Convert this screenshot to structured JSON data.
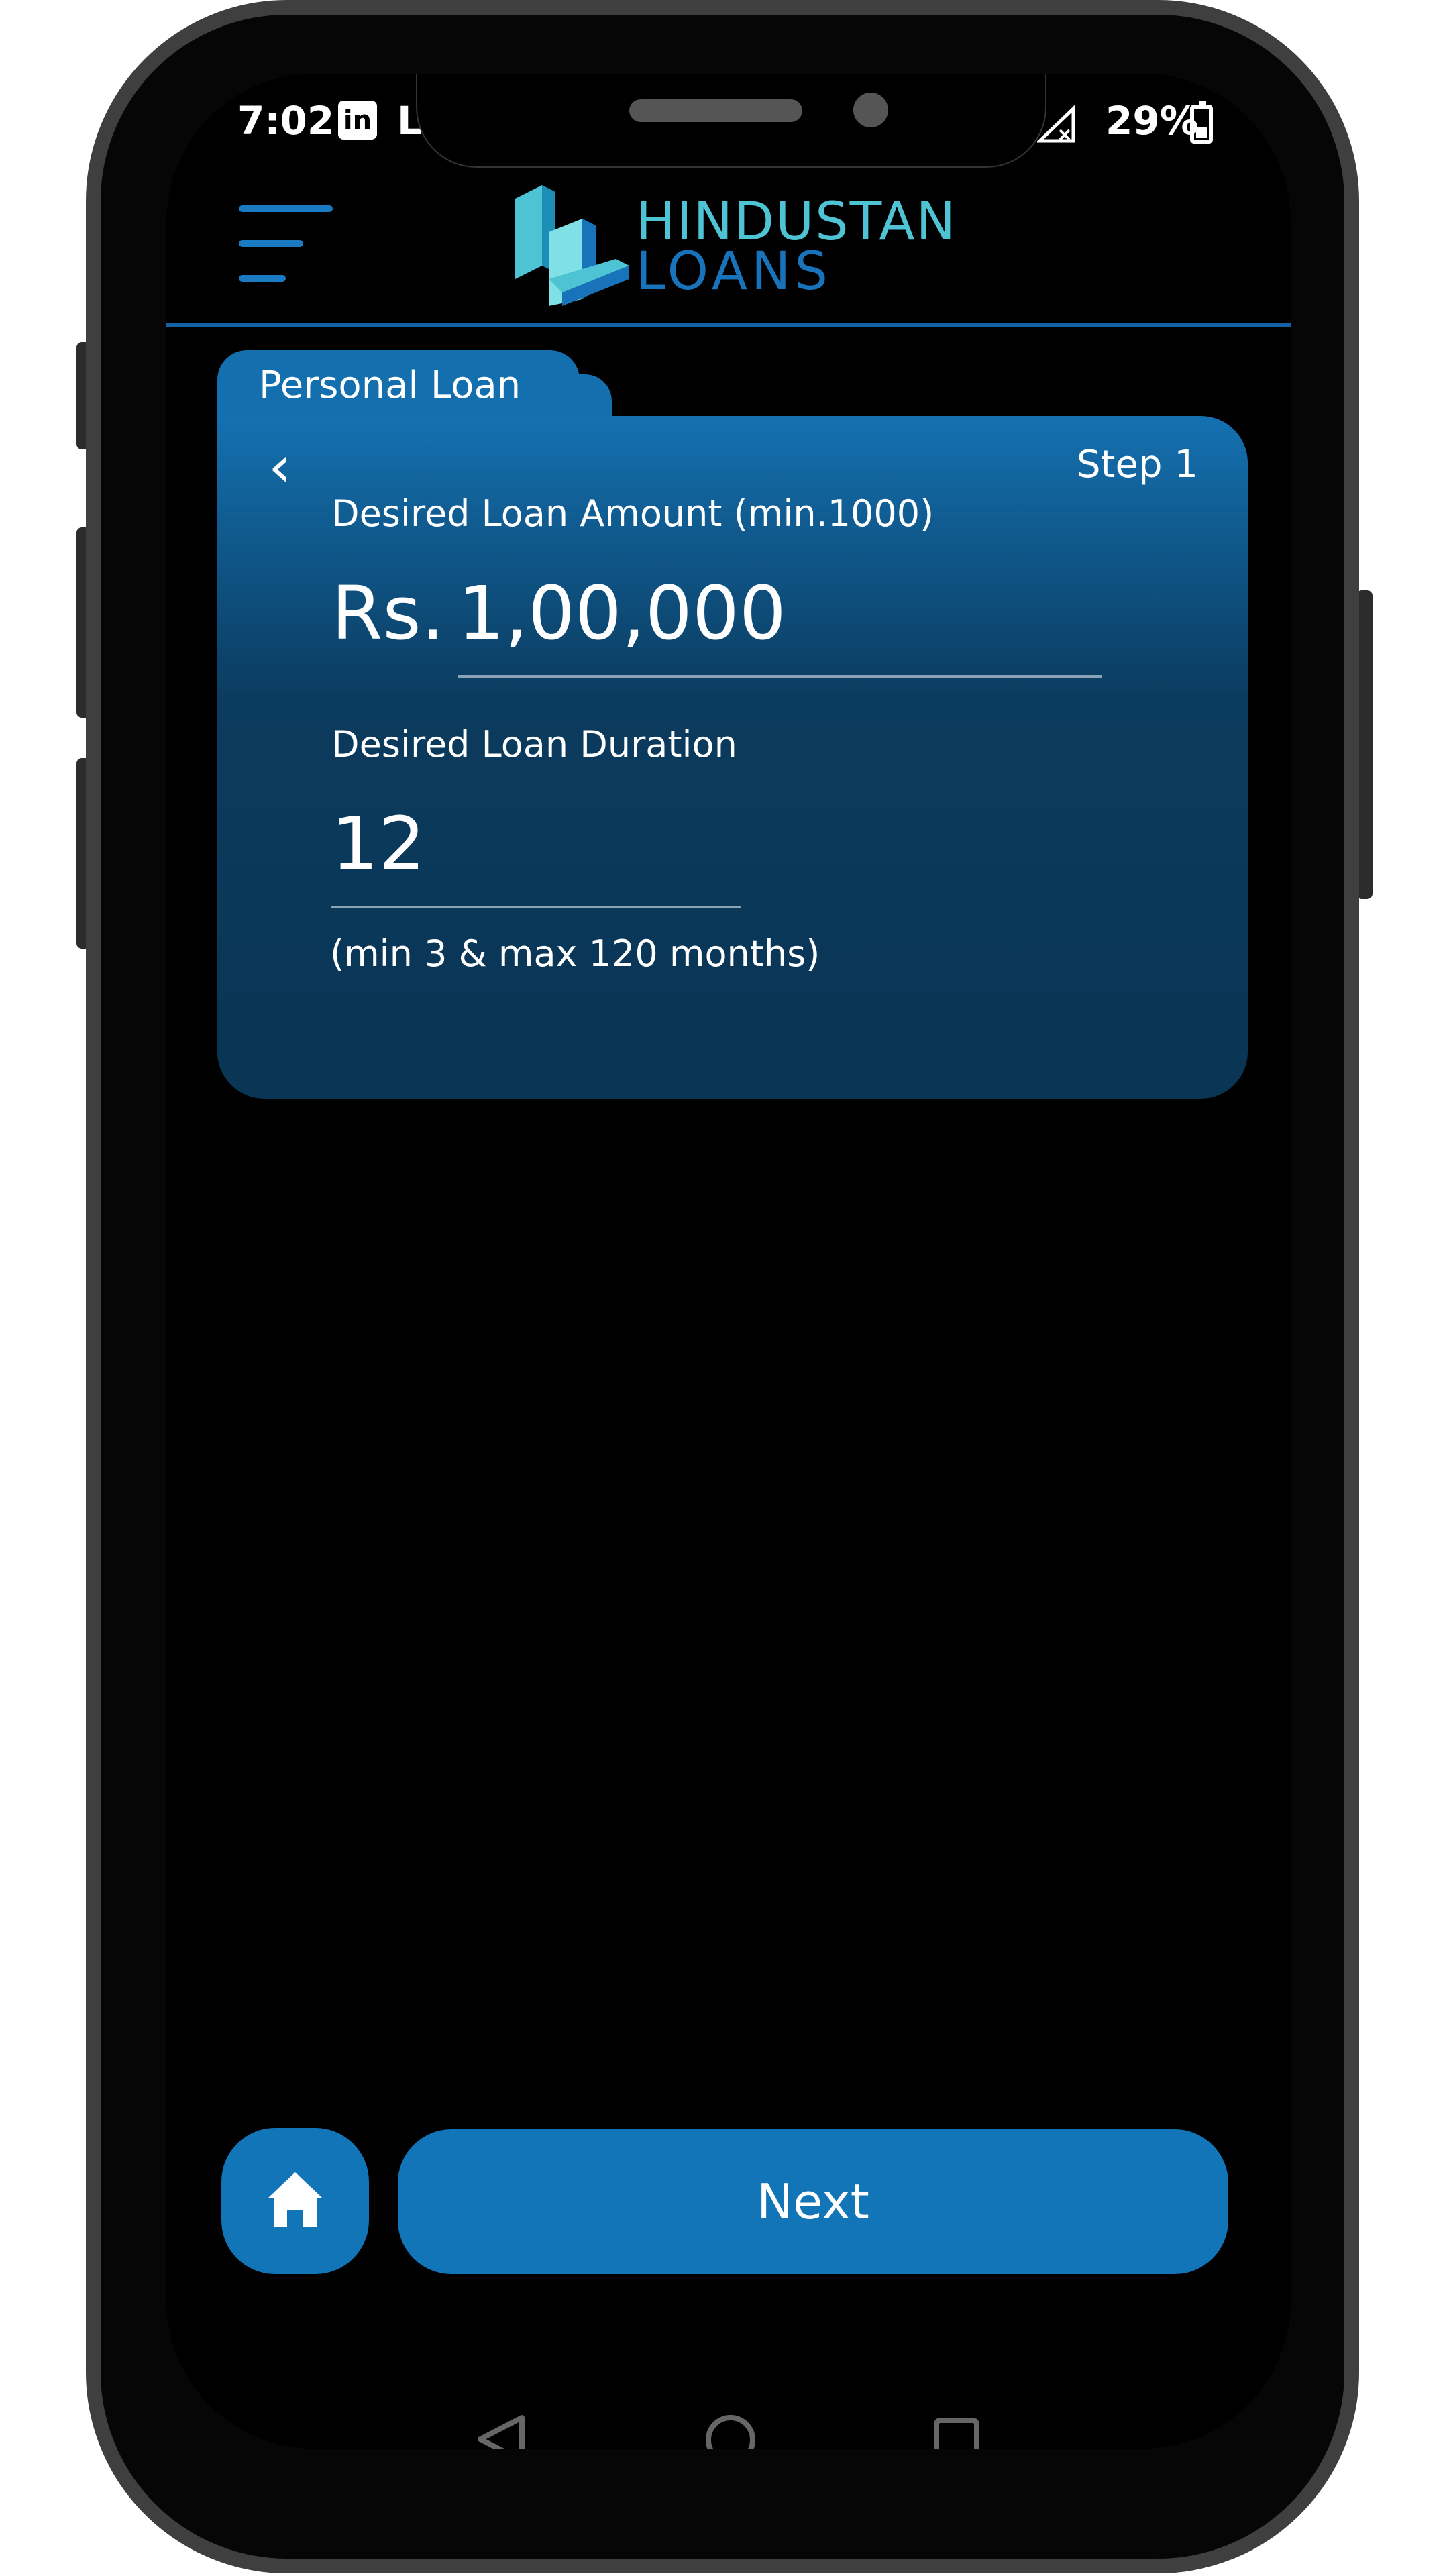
{
  "status_bar": {
    "time": "7:02",
    "linkedin_icon": "in",
    "app_fragment": "L",
    "battery": "29%"
  },
  "header": {
    "logo_line1": "HINDUSTAN",
    "logo_line2": "LOANS"
  },
  "card": {
    "tab_label": "Personal Loan",
    "step_label": "Step 1",
    "amount_label": "Desired Loan Amount (min.1000)",
    "currency_prefix": "Rs.",
    "amount_value": "1,00,000",
    "duration_label": "Desired Loan Duration",
    "duration_value": "12",
    "duration_hint": "(min 3 & max 120 months)"
  },
  "buttons": {
    "next_label": "Next"
  },
  "colors": {
    "accent": "#1275b8",
    "logo_cyan": "#4ec3d3",
    "logo_blue": "#1873bb"
  },
  "icons": {
    "menu": "menu-icon",
    "back": "chevron-left-icon",
    "home": "home-icon"
  }
}
